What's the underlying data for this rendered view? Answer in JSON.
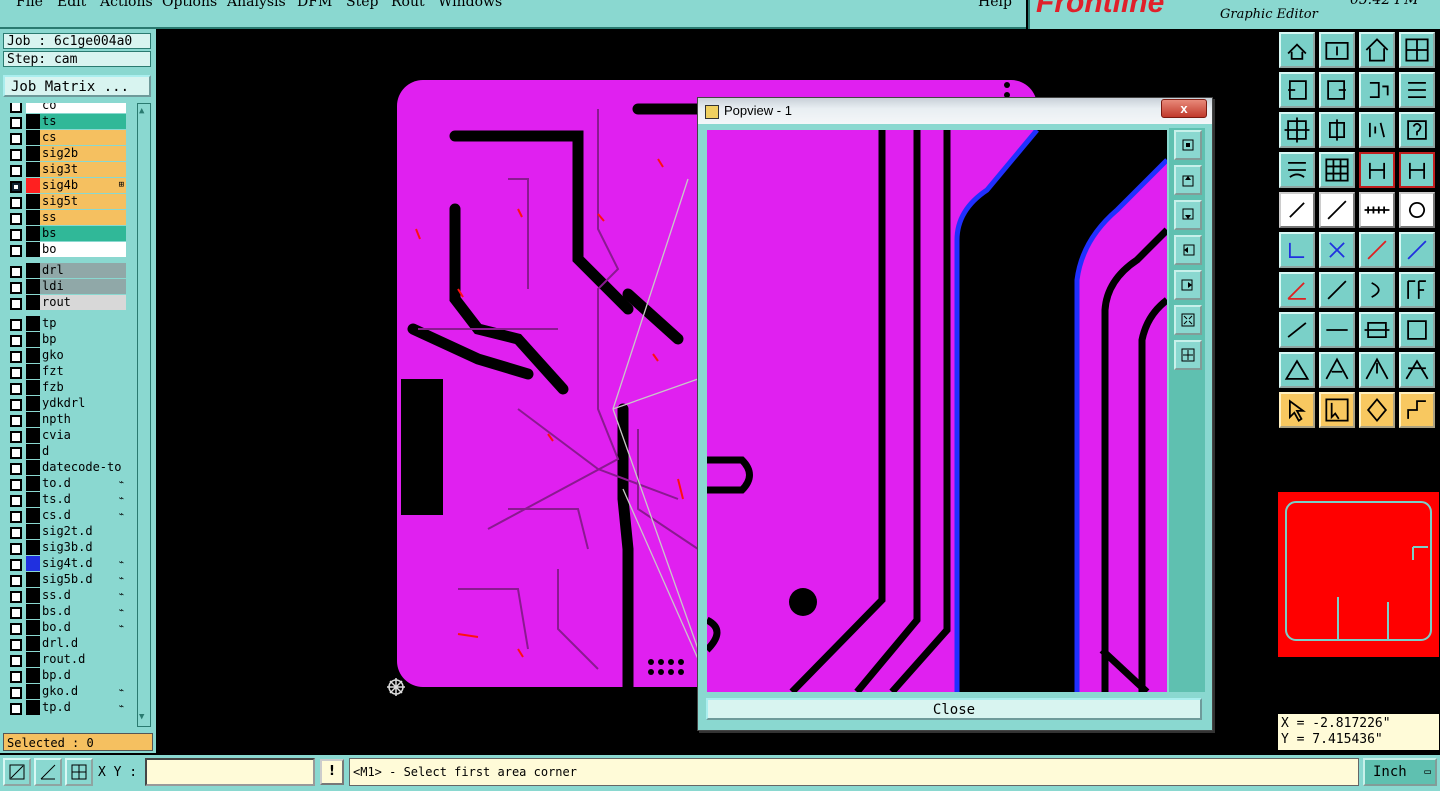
{
  "menubar": {
    "items": [
      "File",
      "Edit",
      "Actions",
      "Options",
      "Analysis",
      "DFM",
      "Step",
      "Rout",
      "Windows"
    ],
    "help": "Help"
  },
  "brand": {
    "logo": "Frontline",
    "subtitle": "Graphic Editor",
    "clock": "05:42 PM"
  },
  "job": {
    "job_label": "Job : 6c1ge004a0",
    "step_label": "Step: cam",
    "job_matrix": "Job Matrix ..."
  },
  "layers": [
    {
      "name": "co",
      "color": "#ffffff",
      "bg": "#ffffff",
      "checked": false,
      "mark": ""
    },
    {
      "name": "ts",
      "color": "#000000",
      "bg": "#30b898",
      "checked": false,
      "mark": ""
    },
    {
      "name": "cs",
      "color": "#000000",
      "bg": "#f5c060",
      "checked": false,
      "mark": ""
    },
    {
      "name": "sig2b",
      "color": "#000000",
      "bg": "#f5c060",
      "checked": false,
      "mark": ""
    },
    {
      "name": "sig3t",
      "color": "#000000",
      "bg": "#f5c060",
      "checked": false,
      "mark": ""
    },
    {
      "name": "sig4b",
      "color": "#ff2020",
      "bg": "#f5c060",
      "checked": true,
      "mark": "⊞"
    },
    {
      "name": "sig5t",
      "color": "#000000",
      "bg": "#f5c060",
      "checked": false,
      "mark": ""
    },
    {
      "name": "ss",
      "color": "#000000",
      "bg": "#f5c060",
      "checked": false,
      "mark": ""
    },
    {
      "name": "bs",
      "color": "#000000",
      "bg": "#30b898",
      "checked": false,
      "mark": ""
    },
    {
      "name": "bo",
      "color": "#000000",
      "bg": "#ffffff",
      "checked": false,
      "mark": ""
    },
    {
      "name": "drl",
      "color": "#000000",
      "bg": "#90a8a8",
      "checked": false,
      "mark": ""
    },
    {
      "name": "ldi",
      "color": "#000000",
      "bg": "#90a8a8",
      "checked": false,
      "mark": ""
    },
    {
      "name": "rout",
      "color": "#000000",
      "bg": "#d8d8d8",
      "checked": false,
      "mark": ""
    },
    {
      "name": "tp",
      "color": "#000000",
      "bg": "#8ad8d0",
      "checked": false,
      "mark": ""
    },
    {
      "name": "bp",
      "color": "#000000",
      "bg": "#8ad8d0",
      "checked": false,
      "mark": ""
    },
    {
      "name": "gko",
      "color": "#000000",
      "bg": "#8ad8d0",
      "checked": false,
      "mark": ""
    },
    {
      "name": "fzt",
      "color": "#000000",
      "bg": "#8ad8d0",
      "checked": false,
      "mark": ""
    },
    {
      "name": "fzb",
      "color": "#000000",
      "bg": "#8ad8d0",
      "checked": false,
      "mark": ""
    },
    {
      "name": "ydkdrl",
      "color": "#000000",
      "bg": "#8ad8d0",
      "checked": false,
      "mark": ""
    },
    {
      "name": "npth",
      "color": "#000000",
      "bg": "#8ad8d0",
      "checked": false,
      "mark": ""
    },
    {
      "name": "cvia",
      "color": "#000000",
      "bg": "#8ad8d0",
      "checked": false,
      "mark": ""
    },
    {
      "name": "d",
      "color": "#000000",
      "bg": "#8ad8d0",
      "checked": false,
      "mark": ""
    },
    {
      "name": "datecode-to",
      "color": "#000000",
      "bg": "#8ad8d0",
      "checked": false,
      "mark": ""
    },
    {
      "name": "to.d",
      "color": "#000000",
      "bg": "#8ad8d0",
      "checked": false,
      "mark": "⌁"
    },
    {
      "name": "ts.d",
      "color": "#000000",
      "bg": "#8ad8d0",
      "checked": false,
      "mark": "⌁"
    },
    {
      "name": "cs.d",
      "color": "#000000",
      "bg": "#8ad8d0",
      "checked": false,
      "mark": "⌁"
    },
    {
      "name": "sig2t.d",
      "color": "#000000",
      "bg": "#8ad8d0",
      "checked": false,
      "mark": ""
    },
    {
      "name": "sig3b.d",
      "color": "#000000",
      "bg": "#8ad8d0",
      "checked": false,
      "mark": ""
    },
    {
      "name": "sig4t.d",
      "color": "#2030e0",
      "bg": "#8ad8d0",
      "checked": false,
      "mark": "⌁"
    },
    {
      "name": "sig5b.d",
      "color": "#000000",
      "bg": "#8ad8d0",
      "checked": false,
      "mark": "⌁"
    },
    {
      "name": "ss.d",
      "color": "#000000",
      "bg": "#8ad8d0",
      "checked": false,
      "mark": "⌁"
    },
    {
      "name": "bs.d",
      "color": "#000000",
      "bg": "#8ad8d0",
      "checked": false,
      "mark": "⌁"
    },
    {
      "name": "bo.d",
      "color": "#000000",
      "bg": "#8ad8d0",
      "checked": false,
      "mark": "⌁"
    },
    {
      "name": "drl.d",
      "color": "#000000",
      "bg": "#8ad8d0",
      "checked": false,
      "mark": ""
    },
    {
      "name": "rout.d",
      "color": "#000000",
      "bg": "#8ad8d0",
      "checked": false,
      "mark": ""
    },
    {
      "name": "bp.d",
      "color": "#000000",
      "bg": "#8ad8d0",
      "checked": false,
      "mark": ""
    },
    {
      "name": "gko.d",
      "color": "#000000",
      "bg": "#8ad8d0",
      "checked": false,
      "mark": "⌁"
    },
    {
      "name": "tp.d",
      "color": "#000000",
      "bg": "#8ad8d0",
      "checked": false,
      "mark": "⌁"
    }
  ],
  "selected_label": "Selected : 0",
  "popview": {
    "title": "Popview - 1",
    "close_x": "x",
    "close_button": "Close"
  },
  "coords": {
    "x": "X = -2.817226\"",
    "y": "Y = 7.415436\""
  },
  "bottom": {
    "xy_label": "X Y :",
    "xy_value": "",
    "exclaim": "!",
    "prompt": "<M1> - Select first area corner",
    "units": "Inch"
  },
  "colors": {
    "panel": "#8ad8d0",
    "board": "#e020f0",
    "trace_red": "#ff1010",
    "trace_blue": "#2030ff",
    "highlight_orange": "#f5c060"
  }
}
